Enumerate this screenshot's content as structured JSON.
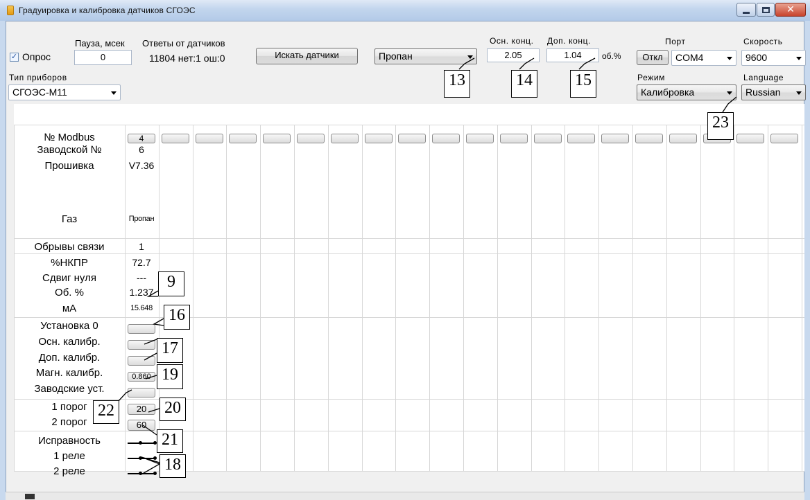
{
  "window": {
    "title": "Градуировка и калибровка датчиков СГОЭС"
  },
  "poll": {
    "checkbox_label": "Опрос",
    "checked": true
  },
  "pause": {
    "label": "Пауза, мсек",
    "value": "0"
  },
  "responses": {
    "label": "Ответы от датчиков",
    "value": "11804 нет:1 ош:0"
  },
  "search_button": "Искать датчики",
  "gas_select": "Пропан",
  "main_conc": {
    "label": "Осн. конц.",
    "value": "2.05"
  },
  "extra_conc": {
    "label": "Доп. конц.",
    "value": "1.04",
    "unit": "об.%"
  },
  "port": {
    "label": "Порт",
    "toggle": "Откл",
    "value": "COM4"
  },
  "speed": {
    "label": "Скорость",
    "value": "9600"
  },
  "device_type": {
    "label": "Тип приборов",
    "value": "СГОЭС-М11"
  },
  "mode": {
    "label": "Режим",
    "value": "Калибровка"
  },
  "language": {
    "label": "Language",
    "value": "Russian"
  },
  "rows": {
    "modbus": "№ Modbus",
    "serial": "Заводской №",
    "firmware": "Прошивка",
    "gas": "Газ",
    "link_breaks": "Обрывы связи",
    "lel": "%НКПР",
    "zero_shift": "Сдвиг нуля",
    "vol": "Об. %",
    "ma": "мА",
    "set_zero": "Установка 0",
    "main_cal": "Осн. калибр.",
    "extra_cal": "Доп. калибр.",
    "magn_cal": "Магн. калибр.",
    "factory": "Заводские уст.",
    "threshold1": "1 порог",
    "threshold2": "2 порог",
    "health": "Исправность",
    "relay1": "1 реле",
    "relay2": "2 реле"
  },
  "sensor1": {
    "modbus": "4",
    "serial": "6",
    "firmware": "V7.36",
    "gas": "Пропан",
    "link_breaks": "1",
    "lel": "72.7",
    "zero_shift": "---",
    "vol": "1.237",
    "ma": "15.648",
    "magn_cal": "0.860",
    "threshold1": "20",
    "threshold2": "60"
  },
  "callouts": [
    "13",
    "14",
    "15",
    "23",
    "9",
    "16",
    "17",
    "19",
    "22",
    "20",
    "21",
    "18"
  ]
}
